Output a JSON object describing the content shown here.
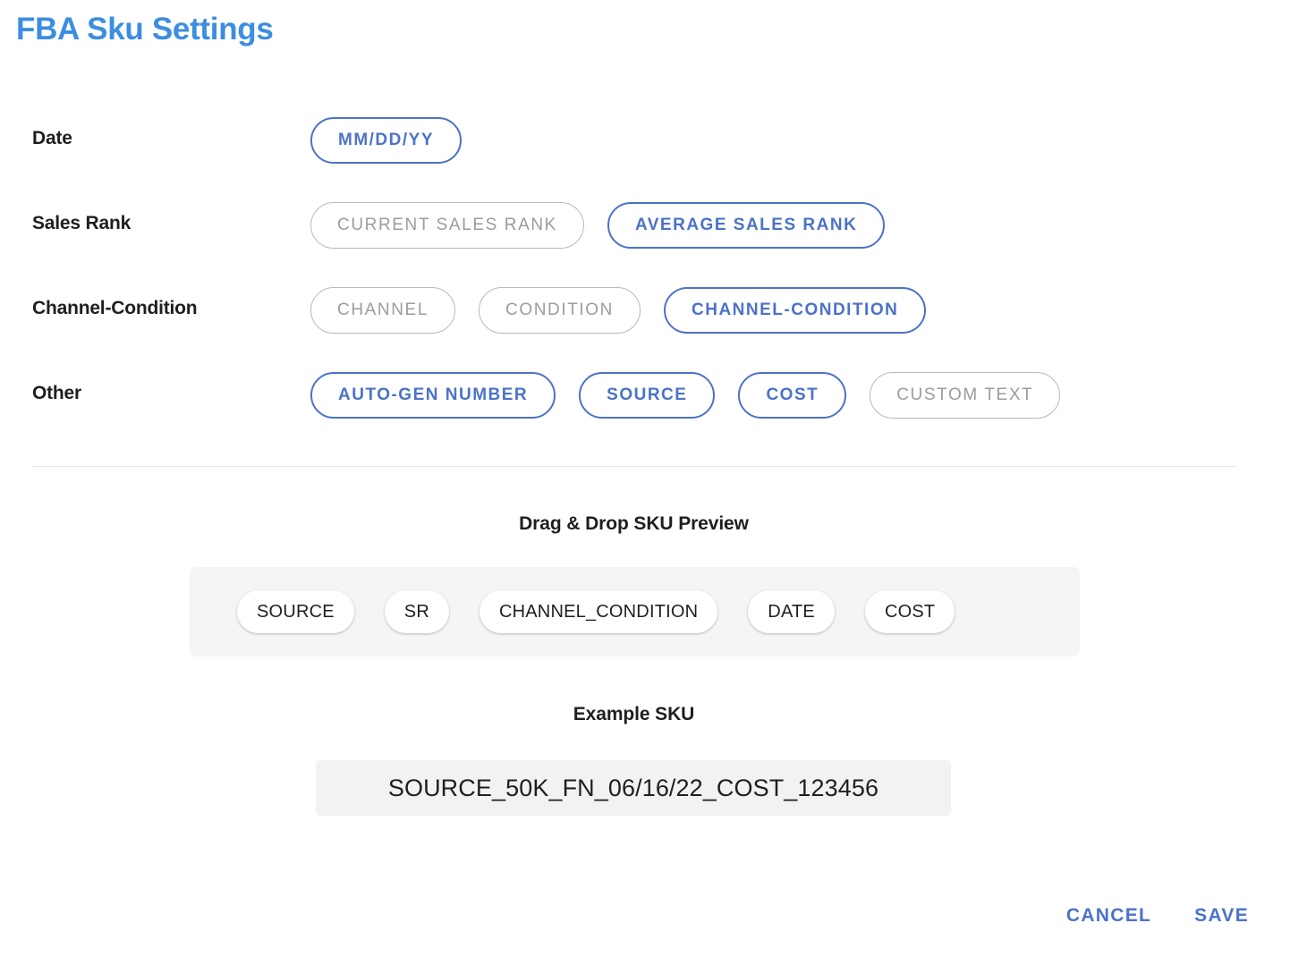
{
  "dialog": {
    "title": "FBA Sku Settings",
    "title_color": "#3b8ee0"
  },
  "colors": {
    "selected_blue": "#4c72c8",
    "unselected_grey": "#9c9c9c",
    "unselected_border": "#b9b9b9",
    "zone_background": "#f5f5f5",
    "example_background": "#f2f2f2"
  },
  "rows": [
    {
      "label": "Date",
      "chips": [
        {
          "label": "MM/DD/YY",
          "state": "selected"
        }
      ]
    },
    {
      "label": "Sales Rank",
      "chips": [
        {
          "label": "CURRENT SALES RANK",
          "state": "unselected"
        },
        {
          "label": "AVERAGE SALES RANK",
          "state": "selected"
        }
      ]
    },
    {
      "label": "Channel-Condition",
      "chips": [
        {
          "label": "CHANNEL",
          "state": "unselected"
        },
        {
          "label": "CONDITION",
          "state": "unselected"
        },
        {
          "label": "CHANNEL-CONDITION",
          "state": "selected"
        }
      ]
    },
    {
      "label": "Other",
      "chips": [
        {
          "label": "AUTO-GEN NUMBER",
          "state": "selected"
        },
        {
          "label": "SOURCE",
          "state": "selected"
        },
        {
          "label": "COST",
          "state": "selected"
        },
        {
          "label": "CUSTOM TEXT",
          "state": "unselected"
        }
      ]
    }
  ],
  "preview": {
    "heading": "Drag & Drop SKU Preview",
    "tokens": [
      "SOURCE",
      "SR",
      "CHANNEL_CONDITION",
      "DATE",
      "COST"
    ]
  },
  "example": {
    "heading": "Example SKU",
    "value": "SOURCE_50K_FN_06/16/22_COST_123456"
  },
  "footer": {
    "cancel_label": "CANCEL",
    "save_label": "SAVE"
  }
}
